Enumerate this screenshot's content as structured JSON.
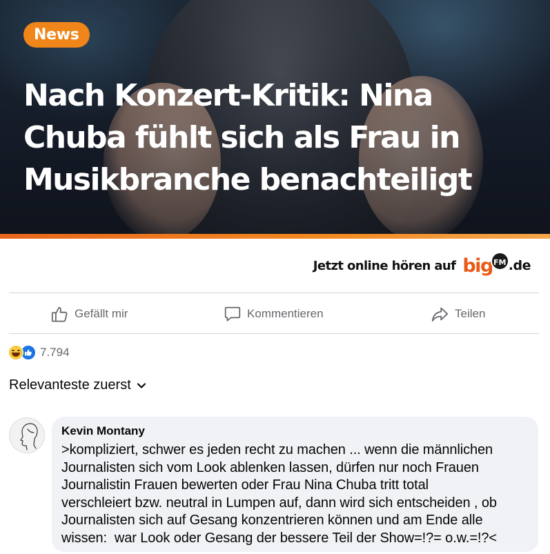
{
  "post": {
    "badge": "News",
    "headline": "Nach Konzert-Kritik: Nina Chuba fühlt sich als Frau in Musikbranche benachteiligt",
    "ad": {
      "text": "Jetzt online hören auf",
      "logo_big": "big",
      "logo_fm": "FM",
      "logo_de": ".de"
    }
  },
  "actions": {
    "like_label": "Gefällt mir",
    "comment_label": "Kommentieren",
    "share_label": "Teilen"
  },
  "reactions": {
    "count": "7.794",
    "types": [
      "haha",
      "like"
    ]
  },
  "sort": {
    "label": "Relevanteste zuerst"
  },
  "comment": {
    "author": "Kevin Montany",
    "text": ">kompliziert, schwer es jeden recht zu machen ... wenn die männlichen\nJournalisten sich vom Look ablenken lassen, dürfen nur noch Frauen\nJournalistin Frauen bewerten oder Frau Nina Chuba tritt total\nverschleiert bzw. neutral in Lumpen auf, dann wird sich entscheiden , ob\nJournalisten sich auf Gesang konzentrieren können und am Ende alle\nwissen:  war Look oder Gesang der bessere Teil der Show=!?= o.w.=!?<"
  },
  "colors": {
    "accent_orange": "#f08619",
    "facebook_blue": "#1b74e4",
    "muted_text": "#65676b",
    "bubble_bg": "#f0f2f5"
  },
  "icons": [
    "thumbs-up-icon",
    "comment-icon",
    "share-arrow-icon",
    "chevron-down-icon",
    "haha-reaction-icon",
    "like-reaction-icon"
  ]
}
